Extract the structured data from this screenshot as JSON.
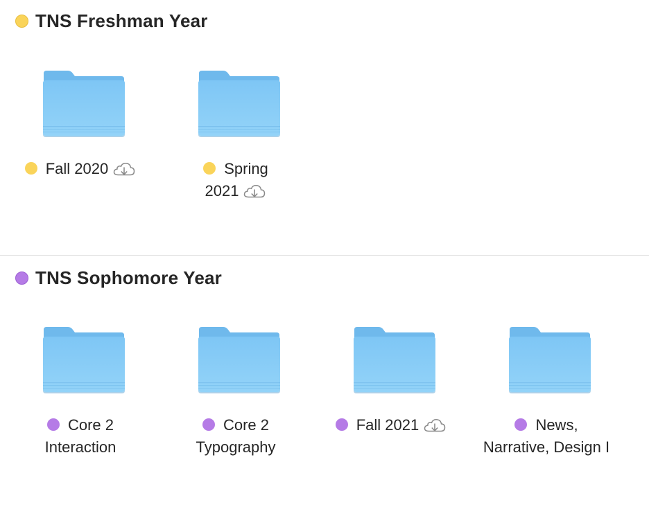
{
  "colors": {
    "yellow_tag": "#FAD45A",
    "purple_tag": "#B57BE6",
    "folder_front": "#88CEF6",
    "folder_back": "#6CB7EC",
    "separator": "#DCDCDC"
  },
  "groups": [
    {
      "title": "TNS Freshman Year",
      "tag_color": "yellow",
      "items": [
        {
          "line1": "Fall 2020",
          "line2": "",
          "icloud": "cloud-download-icon",
          "tag_color": "yellow"
        },
        {
          "line1": "Spring",
          "line2": "2021",
          "icloud": "cloud-download-icon",
          "tag_color": "yellow"
        }
      ]
    },
    {
      "title": "TNS Sophomore Year",
      "tag_color": "purple",
      "items": [
        {
          "line1": "Core 2",
          "line2": "Interaction",
          "tag_color": "purple"
        },
        {
          "line1": "Core 2",
          "line2": "Typography",
          "tag_color": "purple"
        },
        {
          "line1": "Fall 2021",
          "line2": "",
          "icloud": "cloud-download-icon",
          "tag_color": "purple"
        },
        {
          "line1": "News,",
          "line2": "Narrative, Design I",
          "tag_color": "purple"
        }
      ]
    }
  ]
}
